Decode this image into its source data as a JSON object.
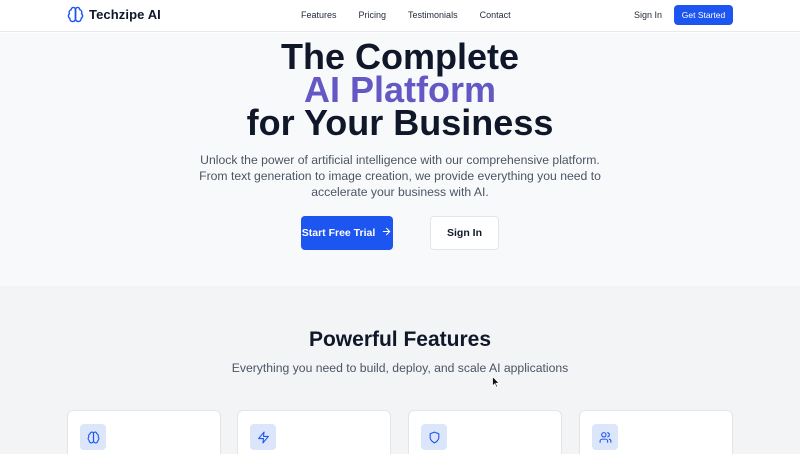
{
  "nav": {
    "brand": "Techzipe AI",
    "brand_icon": "brain-icon",
    "links": [
      "Features",
      "Pricing",
      "Testimonials",
      "Contact"
    ],
    "sign_in": "Sign In",
    "get_started": "Get Started"
  },
  "hero": {
    "title_line1": "The Complete",
    "title_line2": "AI Platform",
    "title_line3": "for Your Business",
    "description": "Unlock the power of artificial intelligence with our comprehensive platform. From text generation to image creation, we provide everything you need to accelerate your business with AI.",
    "cta_primary": "Start Free Trial",
    "cta_primary_icon": "arrow-right-icon",
    "cta_secondary": "Sign In"
  },
  "features": {
    "title": "Powerful Features",
    "subtitle": "Everything you need to build, deploy, and scale AI applications",
    "cards": [
      {
        "icon": "brain-icon"
      },
      {
        "icon": "lightning-icon"
      },
      {
        "icon": "shield-icon"
      },
      {
        "icon": "users-icon"
      }
    ]
  },
  "colors": {
    "accent": "#1c55f0",
    "highlight": "#6557c4",
    "text": "#0f1729",
    "muted": "#4b5563",
    "icon_bg": "#dbe6fb"
  }
}
